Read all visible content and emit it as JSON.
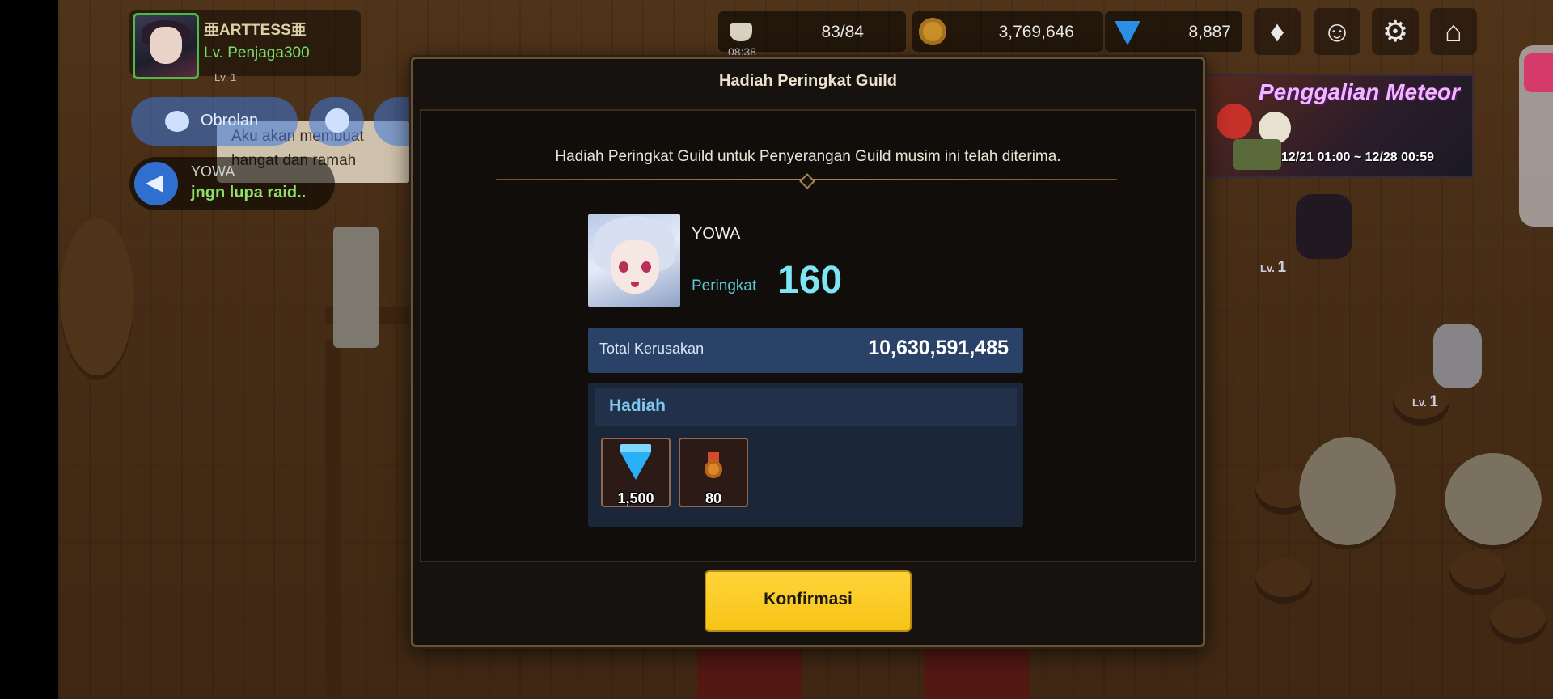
{
  "player": {
    "name": "亜ARTTESS亜",
    "level": "Lv. Penjaga300",
    "lv_tag": "Lv. 1"
  },
  "chat": {
    "button_label": "Obrolan",
    "npc_speech": "Aku akan membuat hangat dan ramah",
    "announce_sender": "YOWA",
    "announce_message": "jngn lupa raid.."
  },
  "resources": {
    "stamina": "83/84",
    "stamina_timer": "08:38",
    "gold": "3,769,646",
    "gems": "8,887"
  },
  "hud_icons": [
    "guild-icon",
    "monster-icon",
    "gear-icon",
    "home-icon"
  ],
  "event": {
    "title": "Penggalian Meteor",
    "dates": "12/21 01:00 ~ 12/28 00:59"
  },
  "npcs": [
    {
      "lv_label": "Lv.",
      "lv": "1"
    },
    {
      "lv_label": "Lv.",
      "lv": "1"
    }
  ],
  "modal": {
    "title": "Hadiah Peringkat Guild",
    "description": "Hadiah Peringkat Guild untuk Penyerangan Guild musim ini telah diterima.",
    "guild_name": "YOWA",
    "rank_label": "Peringkat",
    "rank_value": "160",
    "damage_label": "Total Kerusakan",
    "damage_value": "10,630,591,485",
    "reward_title": "Hadiah",
    "rewards": [
      {
        "icon": "gem-icon",
        "qty": "1,500"
      },
      {
        "icon": "medal-icon",
        "qty": "80"
      }
    ],
    "confirm_label": "Konfirmasi"
  },
  "colors": {
    "accent_yellow": "#f6c416",
    "rank_cyan": "#7ee6f2",
    "reward_title": "#7cc8f0",
    "panel_border": "#6b5231"
  }
}
